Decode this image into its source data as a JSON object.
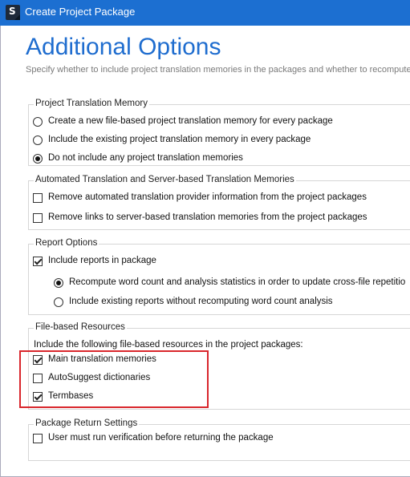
{
  "window": {
    "title": "Create Project Package"
  },
  "page": {
    "heading": "Additional Options",
    "subtitle": "Specify whether to include project translation memories in the packages and whether to recompute word"
  },
  "groups": {
    "ptm": {
      "legend": "Project Translation Memory",
      "options": [
        {
          "label": "Create a new file-based project translation memory for every package",
          "selected": false
        },
        {
          "label": "Include the existing project translation memory in every package",
          "selected": false
        },
        {
          "label": "Do not include any project translation memories",
          "selected": true
        }
      ]
    },
    "atm": {
      "legend": "Automated Translation and Server-based Translation Memories",
      "options": [
        {
          "label": "Remove automated translation provider information from the project packages",
          "checked": false
        },
        {
          "label": "Remove links to server-based translation memories from the project packages",
          "checked": false
        }
      ]
    },
    "report": {
      "legend": "Report Options",
      "include": {
        "label": "Include reports in package",
        "checked": true
      },
      "options": [
        {
          "label": "Recompute word count and analysis statistics in order to update cross-file repetitio",
          "selected": true
        },
        {
          "label": "Include existing reports without recomputing word count analysis",
          "selected": false
        }
      ]
    },
    "resources": {
      "legend": "File-based Resources",
      "intro": "Include the following file-based resources in the project packages:",
      "options": [
        {
          "label": "Main translation memories",
          "checked": true
        },
        {
          "label": "AutoSuggest dictionaries",
          "checked": false
        },
        {
          "label": "Termbases",
          "checked": true
        }
      ]
    },
    "return": {
      "legend": "Package Return Settings",
      "options": [
        {
          "label": "User must run verification before returning the package",
          "checked": false
        }
      ]
    }
  },
  "colors": {
    "titlebar": "#1c6fd1",
    "heading": "#1f6dcf",
    "highlight": "#d9262c"
  }
}
